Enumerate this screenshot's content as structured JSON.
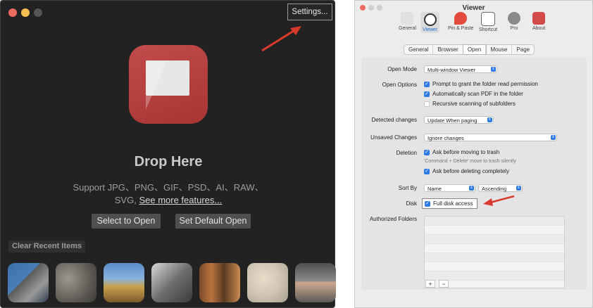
{
  "left_window": {
    "settings_label": "Settings...",
    "drop_title": "Drop Here",
    "support_line1": "Support JPG、PNG、GIF、PSD、AI、RAW、",
    "support_line2_prefix": "SVG, ",
    "see_more_link": "See more features...",
    "select_button": "Select to Open",
    "default_button": "Set Default Open",
    "clear_button": "Clear Recent Items"
  },
  "right_window": {
    "title": "Viewer",
    "toolbar": [
      {
        "label": "General",
        "icon": "phone-icon"
      },
      {
        "label": "Viewer",
        "icon": "magnifier-icon"
      },
      {
        "label": "Pin & Paste",
        "icon": "pin-icon"
      },
      {
        "label": "Shortcut",
        "icon": "command-key-icon"
      },
      {
        "label": "Pro",
        "icon": "gear-icon"
      },
      {
        "label": "About",
        "icon": "app-logo-icon"
      }
    ],
    "tabs": [
      "General",
      "Browser",
      "Open",
      "Mouse",
      "Page"
    ],
    "open_mode_label": "Open Mode",
    "open_mode_value": "Multi-window Viewer",
    "open_options_label": "Open Options",
    "opt1": "Prompt to grant the folder read permission",
    "opt2": "Automatically scan PDF in the folder",
    "opt3": "Recursive scanning of subfolders",
    "detected_label": "Detected changes",
    "detected_value": "Update When paging",
    "unsaved_label": "Unsaved Changes",
    "unsaved_value": "Ignore changes",
    "deletion_label": "Deletion",
    "del1": "Ask before moving to trash",
    "del_note": "'Command + Delete' move to trash silently",
    "del2": "Ask before deleting completely",
    "sortby_label": "Sort By",
    "sortby_value": "Name",
    "sortorder_value": "Ascending",
    "disk_label": "Disk",
    "disk_value": "Full disk access",
    "auth_label": "Authorized Folders",
    "plus": "+",
    "minus": "−"
  },
  "colors": {
    "accent": "#2f7ae5",
    "arrow": "#d93a2b",
    "app_icon": "#b83c3c"
  }
}
